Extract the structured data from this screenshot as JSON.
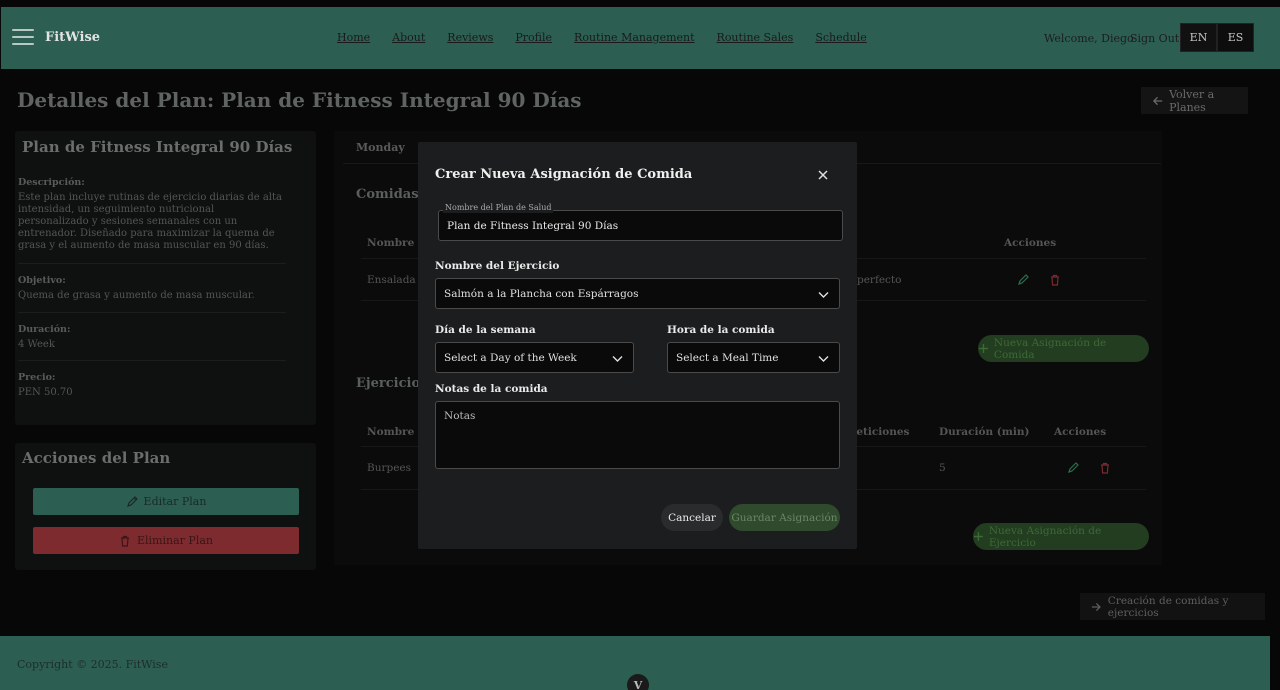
{
  "nav": {
    "brand": "FitWise",
    "links": [
      "Home",
      "About",
      "Reviews",
      "Profile",
      "Routine Management",
      "Routine Sales",
      "Schedule"
    ],
    "welcome": "Welcome, Diego",
    "sign_out": "Sign Out",
    "lang_en": "EN",
    "lang_es": "ES"
  },
  "page": {
    "title": "Detalles del Plan: Plan de Fitness Integral 90 Días",
    "back_label": "Volver a Planes"
  },
  "plan": {
    "card_title": "Plan de Fitness Integral 90 Días",
    "description_label": "Descripción:",
    "description": "Este plan incluye rutinas de ejercicio diarias de alta intensidad, un seguimiento nutricional personalizado y sesiones semanales con un entrenador. Diseñado para maximizar la quema de grasa y el aumento de masa muscular en 90 días.",
    "objective_label": "Objetivo:",
    "objective": "Quema de grasa y aumento de masa muscular.",
    "duration_label": "Duración:",
    "duration": "4 Week",
    "price_label": "Precio:",
    "price": "PEN 50.70"
  },
  "plan_actions": {
    "title": "Acciones del Plan",
    "edit": "Editar Plan",
    "delete": "Eliminar Plan"
  },
  "schedule": {
    "tab": "Monday",
    "meals_heading": "Comidas de",
    "meals_col_name": "Nombre de",
    "meals_col_actions": "Acciones",
    "meal_row_name": "Ensalada Q",
    "meal_row_note": "perfecto",
    "new_meal_btn": "Nueva Asignación de Comida",
    "exercises_heading": "Ejercicios d",
    "ex_col_name": "Nombre de",
    "ex_col_reps": "peticiones",
    "ex_col_duration": "Duración (min)",
    "ex_col_actions": "Acciones",
    "ex_row_name": "Burpees",
    "ex_row_duration": "5",
    "new_ex_btn": "Nueva Asignación de Ejercicio"
  },
  "creation_btn": "Creación de comidas y ejercicios",
  "footer": {
    "copyright": "Copyright © 2025. FitWise",
    "scroll_glyph": "V"
  },
  "modal": {
    "title": "Crear Nueva Asignación de Comida",
    "plan_name_legend": "Nombre del Plan de Salud",
    "plan_name_value": "Plan de Fitness Integral 90 Días",
    "exercise_label": "Nombre del Ejercicio",
    "exercise_value": "Salmón a la Plancha con Espárragos",
    "day_label": "Día de la semana",
    "day_value": "Select a Day of the Week",
    "time_label": "Hora de la comida",
    "time_value": "Select a Meal Time",
    "notes_label": "Notas de la comida",
    "notes_placeholder": "Notas",
    "cancel": "Cancelar",
    "save": "Guardar Asignación"
  },
  "colors": {
    "nav_bg": "#2c5f52",
    "modal_bg": "#1c1d1e",
    "danger": "#7e2b30",
    "success": "#223d1f"
  }
}
